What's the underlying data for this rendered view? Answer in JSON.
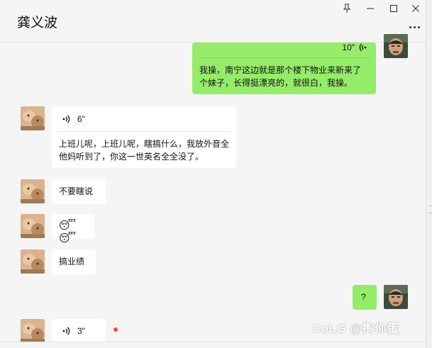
{
  "window": {
    "contact_name": "龚义波",
    "controls": [
      "pin-icon",
      "minimize-icon",
      "maximize-icon",
      "close-icon"
    ],
    "more_icon": "more-dots-icon"
  },
  "colors": {
    "outgoing_bubble": "#95ec69",
    "incoming_bubble": "#ffffff",
    "background": "#f5f5f5",
    "unread_dot": "#f04b40"
  },
  "messages": [
    {
      "direction": "out",
      "type": "voice",
      "duration": "10\"",
      "transcript": "我操，南宁这边就是那个楼下物业来新来了个妹子，长得挺漂亮的，就很白，我操。"
    },
    {
      "direction": "in",
      "type": "voice",
      "duration": "6\"",
      "transcript": "上班儿呢，上班儿呢，瞎搞什么，我放外音全他妈听到了，你这一世英名全全没了。"
    },
    {
      "direction": "in",
      "type": "text",
      "text": "不要瞎说"
    },
    {
      "direction": "in",
      "type": "emoji",
      "text": "😴😴"
    },
    {
      "direction": "in",
      "type": "text",
      "text": "搞业绩"
    },
    {
      "direction": "out",
      "type": "text",
      "text": "?"
    },
    {
      "direction": "in",
      "type": "voice",
      "duration": "3\"",
      "unread": true
    }
  ],
  "watermark": "CoLG @掏你蛋"
}
